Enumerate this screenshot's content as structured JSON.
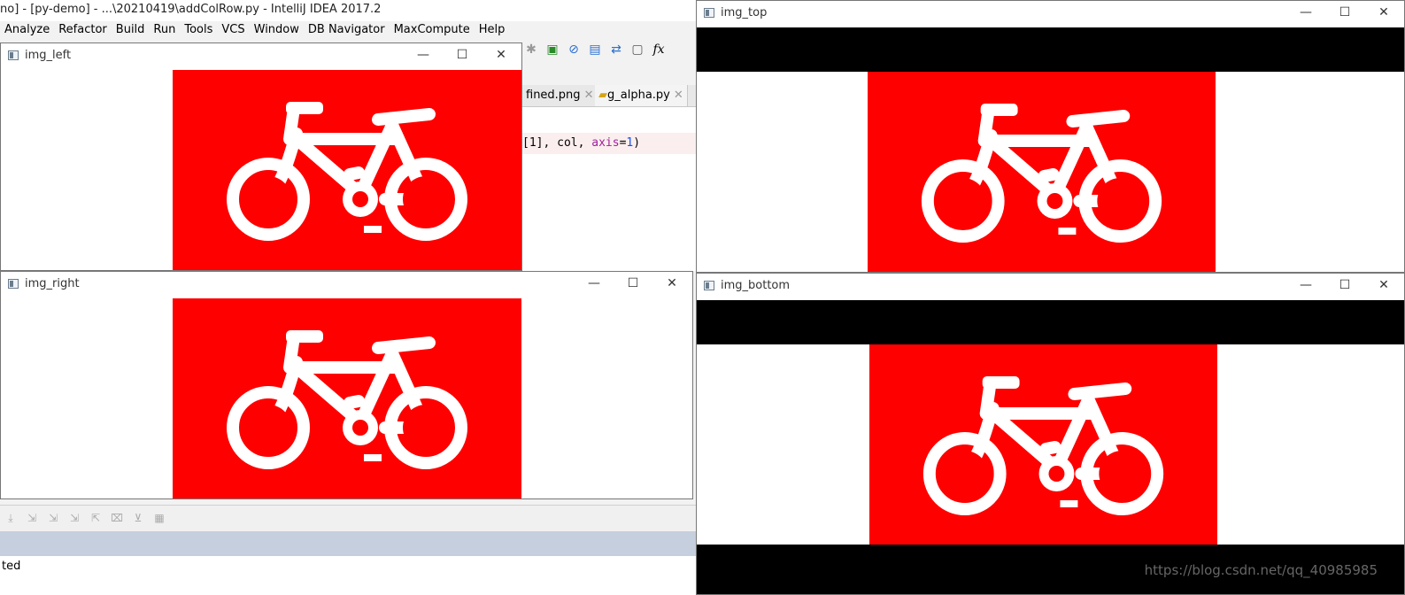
{
  "ide": {
    "title": "no] - [py-demo] - ...\\20210419\\addColRow.py - IntelliJ IDEA 2017.2",
    "menu": [
      "Analyze",
      "Refactor",
      "Build",
      "Run",
      "Tools",
      "VCS",
      "Window",
      "DB Navigator",
      "MaxCompute",
      "Help"
    ],
    "tabs": [
      "fined.png",
      "g_alpha.py"
    ],
    "code_line": {
      "pre": "[1], col, ",
      "kw": "axis",
      "eq": "=",
      "num": "1",
      "post": ")"
    },
    "status_text": "ted"
  },
  "windows": {
    "img_left": {
      "title": "img_left"
    },
    "img_right": {
      "title": "img_right"
    },
    "img_top": {
      "title": "img_top"
    },
    "img_bottom": {
      "title": "img_bottom"
    }
  },
  "controls": {
    "minimize": "—",
    "maximize": "☐",
    "close": "✕"
  },
  "watermark": "https://blog.csdn.net/qq_40985985",
  "colors": {
    "red": "#ff0000",
    "black": "#000000",
    "white": "#ffffff"
  },
  "icons": [
    "bicycle-icon",
    "window-app-icon",
    "minimize-icon",
    "maximize-icon",
    "close-icon"
  ]
}
